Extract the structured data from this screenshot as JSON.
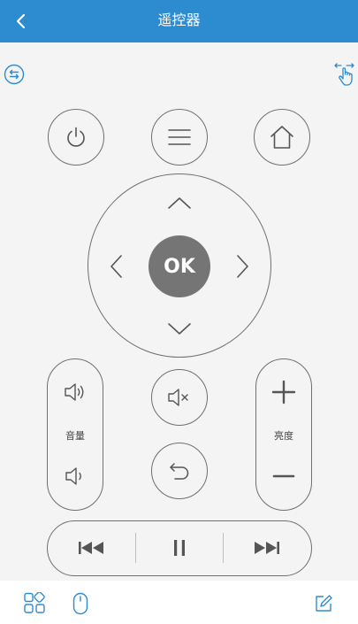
{
  "header": {
    "title": "遥控器"
  },
  "volume": {
    "label": "音量"
  },
  "brightness": {
    "label": "亮度"
  },
  "dpad": {
    "ok_label": "OK"
  },
  "colors": {
    "header": "#2d8bd0",
    "accent_icon": "#2d8bd0",
    "ok": "#757575",
    "stroke": "#6f6f6f"
  },
  "icons": {
    "back": "chevron-left-icon",
    "switch": "swap-arrows-circle-icon",
    "gesture": "touch-gesture-icon",
    "power": "power-icon",
    "menu": "menu-icon",
    "home": "home-icon",
    "mute": "mute-icon",
    "return": "return-icon",
    "prev": "skip-previous-icon",
    "pause": "pause-icon",
    "next": "skip-next-icon",
    "apps": "apps-grid-icon",
    "mouse": "mouse-icon",
    "edit": "edit-icon"
  }
}
